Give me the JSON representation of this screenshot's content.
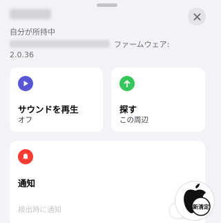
{
  "header": {
    "device_name_redacted": "",
    "owned_text": "自分が所持中",
    "firmware_label": "ファームウェア:",
    "firmware_version": "2.0.36"
  },
  "cards": {
    "sound": {
      "title": "サウンドを再生",
      "subtitle": "オフ",
      "icon": "play-icon",
      "icon_color": "#5856d6"
    },
    "find": {
      "title": "探す",
      "subtitle": "この周辺",
      "icon": "arrow-up-icon",
      "icon_color": "#34c759"
    },
    "notify": {
      "title": "通知",
      "row_label": "検出時に通知",
      "icon": "bell-icon",
      "icon_color": "#ff3b30",
      "toggle_on": false
    }
  },
  "watermark": {
    "label": "新清定"
  }
}
